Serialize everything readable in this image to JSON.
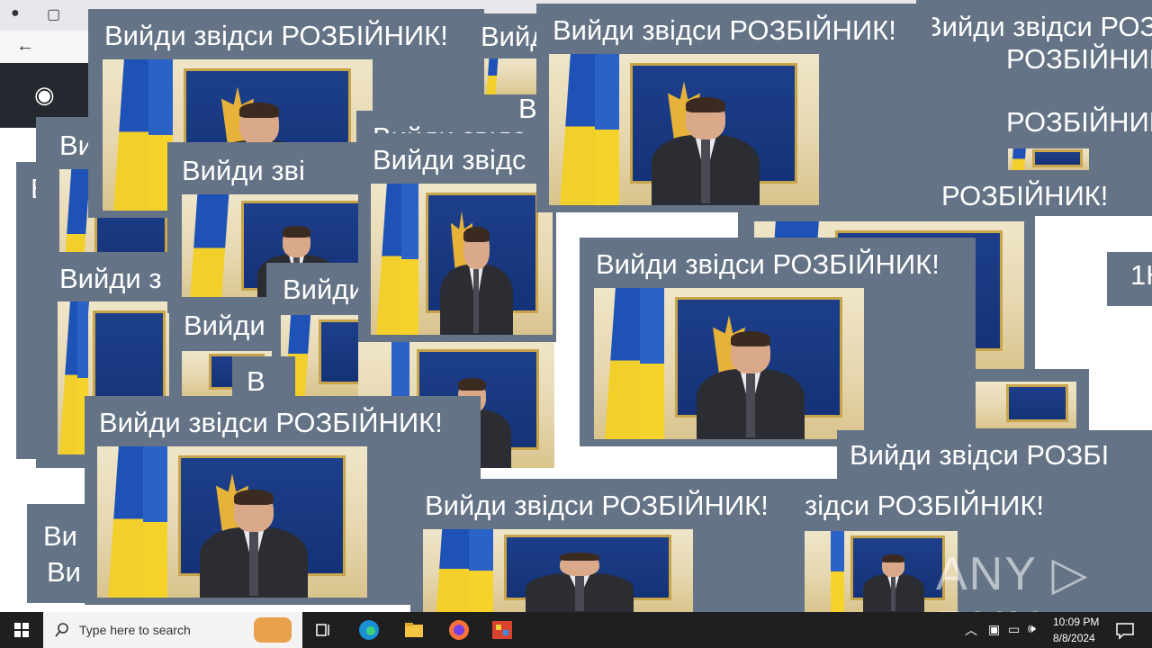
{
  "popup": {
    "caption": "Вийди звідси РОЗБІЙНИК!"
  },
  "fragments": {
    "f1": "Вийди звідси РОЗБІЙНИК!",
    "f2": "Вийди зві",
    "f3": "Вийди з",
    "f4": "Вийди",
    "f5": "Ви",
    "f6": "В",
    "f7": "РОЗБІЙНИК!",
    "f8": "зідси РОЗБІЙНИК!",
    "f9": "Вийди звідси РОЗБІ",
    "f10": "Вийди звідс",
    "f11": "1Н"
  },
  "taskbar": {
    "search_placeholder": "Type here to search",
    "time": "10:09 PM",
    "date": "8/8/2024"
  },
  "watermark": "ANY ▷ RUN",
  "icons": [
    "windows-start-icon",
    "search-icon",
    "task-view-icon",
    "edge-icon",
    "file-explorer-icon",
    "firefox-icon",
    "app-icon",
    "chevron-up-icon",
    "network-icon",
    "volume-icon",
    "notification-icon"
  ]
}
